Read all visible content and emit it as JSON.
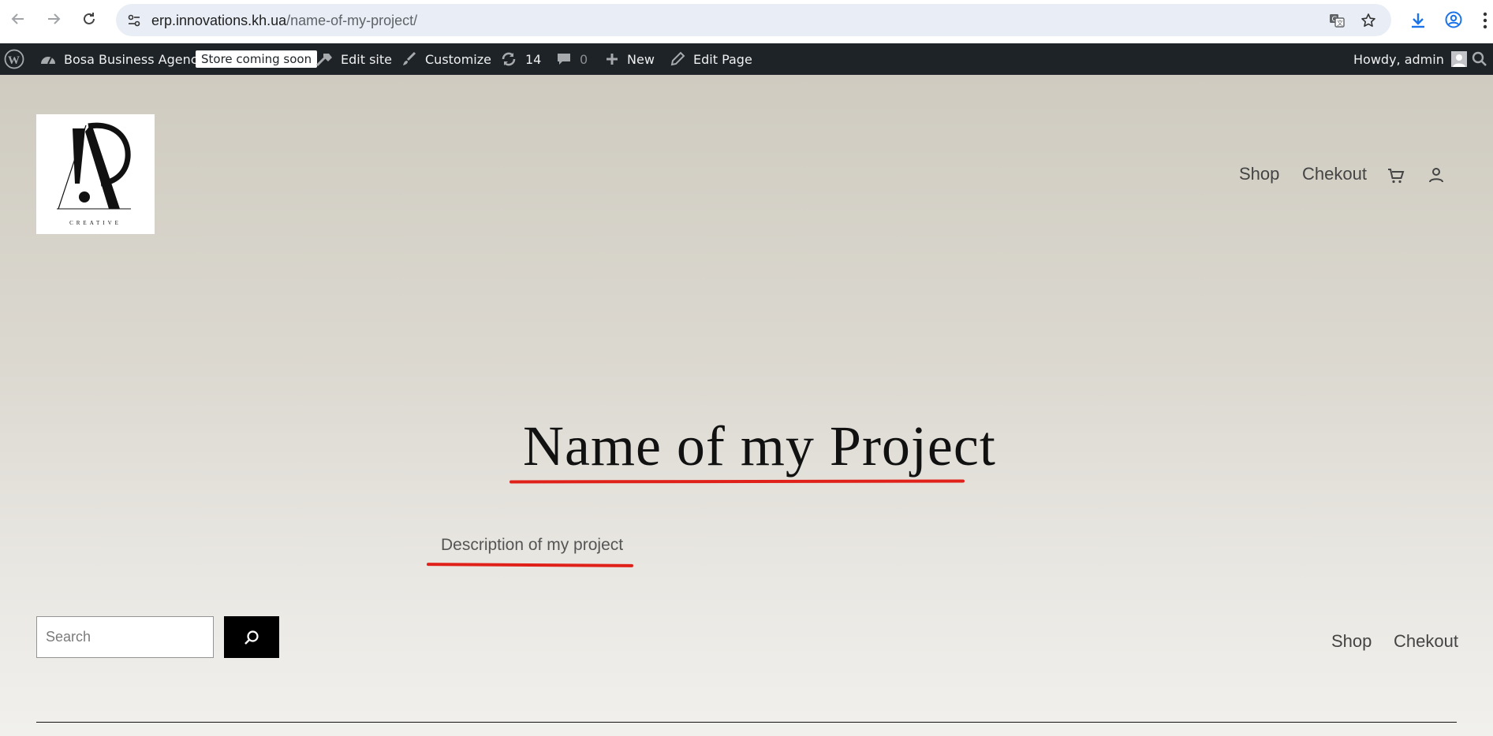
{
  "browser": {
    "url_host": "erp.innovations.kh.ua",
    "url_path": "/name-of-my-project/",
    "icons": [
      "back-arrow-icon",
      "forward-arrow-icon",
      "reload-icon",
      "site-info-icon",
      "translate-icon",
      "bookmark-star-icon",
      "download-icon",
      "profile-icon",
      "menu-dots-icon"
    ]
  },
  "adminbar": {
    "site_name": "Bosa Business Agency",
    "store_badge": "Store coming soon",
    "edit_site": "Edit site",
    "customize": "Customize",
    "updates_count": "14",
    "comments_count": "0",
    "new_label": "New",
    "edit_page": "Edit Page",
    "howdy": "Howdy, admin"
  },
  "header": {
    "logo_subtext": "CREATIVE",
    "nav": [
      "Shop",
      "Chekout"
    ]
  },
  "hero": {
    "title": "Name of my Project",
    "description": "Description of my project",
    "annotation_color": "#e0211a"
  },
  "footer": {
    "search_placeholder": "Search",
    "nav": [
      "Shop",
      "Chekout"
    ]
  }
}
